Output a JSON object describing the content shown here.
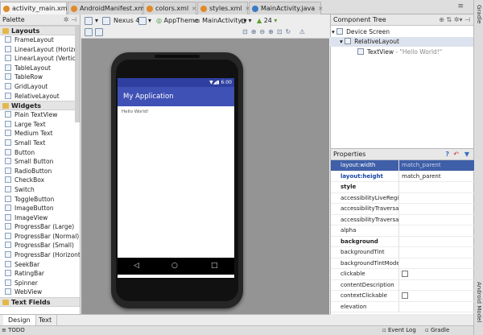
{
  "tabs": [
    {
      "label": "activity_main.xml",
      "active": true
    },
    {
      "label": "AndroidManifest.xml",
      "active": false
    },
    {
      "label": "colors.xml",
      "active": false
    },
    {
      "label": "styles.xml",
      "active": false
    },
    {
      "label": "MainActivity.java",
      "active": false
    }
  ],
  "tab_overflow": "≡",
  "palette": {
    "title": "Palette",
    "groups": [
      {
        "name": "Layouts",
        "items": [
          "FrameLayout",
          "LinearLayout (Horizontal)",
          "LinearLayout (Vertical)",
          "TableLayout",
          "TableRow",
          "GridLayout",
          "RelativeLayout"
        ]
      },
      {
        "name": "Widgets",
        "items": [
          "Plain TextView",
          "Large Text",
          "Medium Text",
          "Small Text",
          "Button",
          "Small Button",
          "RadioButton",
          "CheckBox",
          "Switch",
          "ToggleButton",
          "ImageButton",
          "ImageView",
          "ProgressBar (Large)",
          "ProgressBar (Normal)",
          "ProgressBar (Small)",
          "ProgressBar (Horizontal)",
          "SeekBar",
          "RatingBar",
          "Spinner",
          "WebView"
        ]
      },
      {
        "name": "Text Fields",
        "items": []
      }
    ]
  },
  "toolbar": {
    "device": "Nexus 4",
    "theme": "AppTheme",
    "activity": "MainActivity",
    "api": "24"
  },
  "phone": {
    "status_time": "6:00",
    "app_title": "My Application",
    "content_text": "Hello World!"
  },
  "component_tree": {
    "title": "Component Tree",
    "root": "Device Screen",
    "layout": "RelativeLayout",
    "child_name": "TextView",
    "child_value": "- \"Hello World!\""
  },
  "properties": {
    "title": "Properties",
    "rows": [
      {
        "name": "layout:width",
        "value": "match_parent",
        "style": "sel"
      },
      {
        "name": "layout:height",
        "value": "match_parent",
        "style": "blue"
      },
      {
        "name": "style",
        "value": "",
        "style": "bold"
      },
      {
        "name": "accessibilityLiveRegion",
        "value": "",
        "style": ""
      },
      {
        "name": "accessibilityTraversalAfter",
        "value": "",
        "style": ""
      },
      {
        "name": "accessibilityTraversalBefore",
        "value": "",
        "style": ""
      },
      {
        "name": "alpha",
        "value": "",
        "style": ""
      },
      {
        "name": "background",
        "value": "",
        "style": "bold"
      },
      {
        "name": "backgroundTint",
        "value": "",
        "style": ""
      },
      {
        "name": "backgroundTintMode",
        "value": "",
        "style": ""
      },
      {
        "name": "clickable",
        "value": "",
        "style": "",
        "checkbox": true
      },
      {
        "name": "contentDescription",
        "value": "",
        "style": ""
      },
      {
        "name": "contextClickable",
        "value": "",
        "style": "",
        "checkbox": true
      },
      {
        "name": "elevation",
        "value": "",
        "style": ""
      }
    ]
  },
  "bottom_tabs": [
    {
      "label": "Design",
      "active": true
    },
    {
      "label": "Text",
      "active": false
    }
  ],
  "status": {
    "todo": "TODO",
    "event_log": "Event Log",
    "gradle_console": "Gradle Console"
  },
  "side_strip": {
    "top": "Gradle",
    "bottom": "Android Model"
  },
  "colors": {
    "accent": "#3f51b5",
    "primary_dark": "#2f3fa0",
    "selection": "#3f5fa8"
  }
}
